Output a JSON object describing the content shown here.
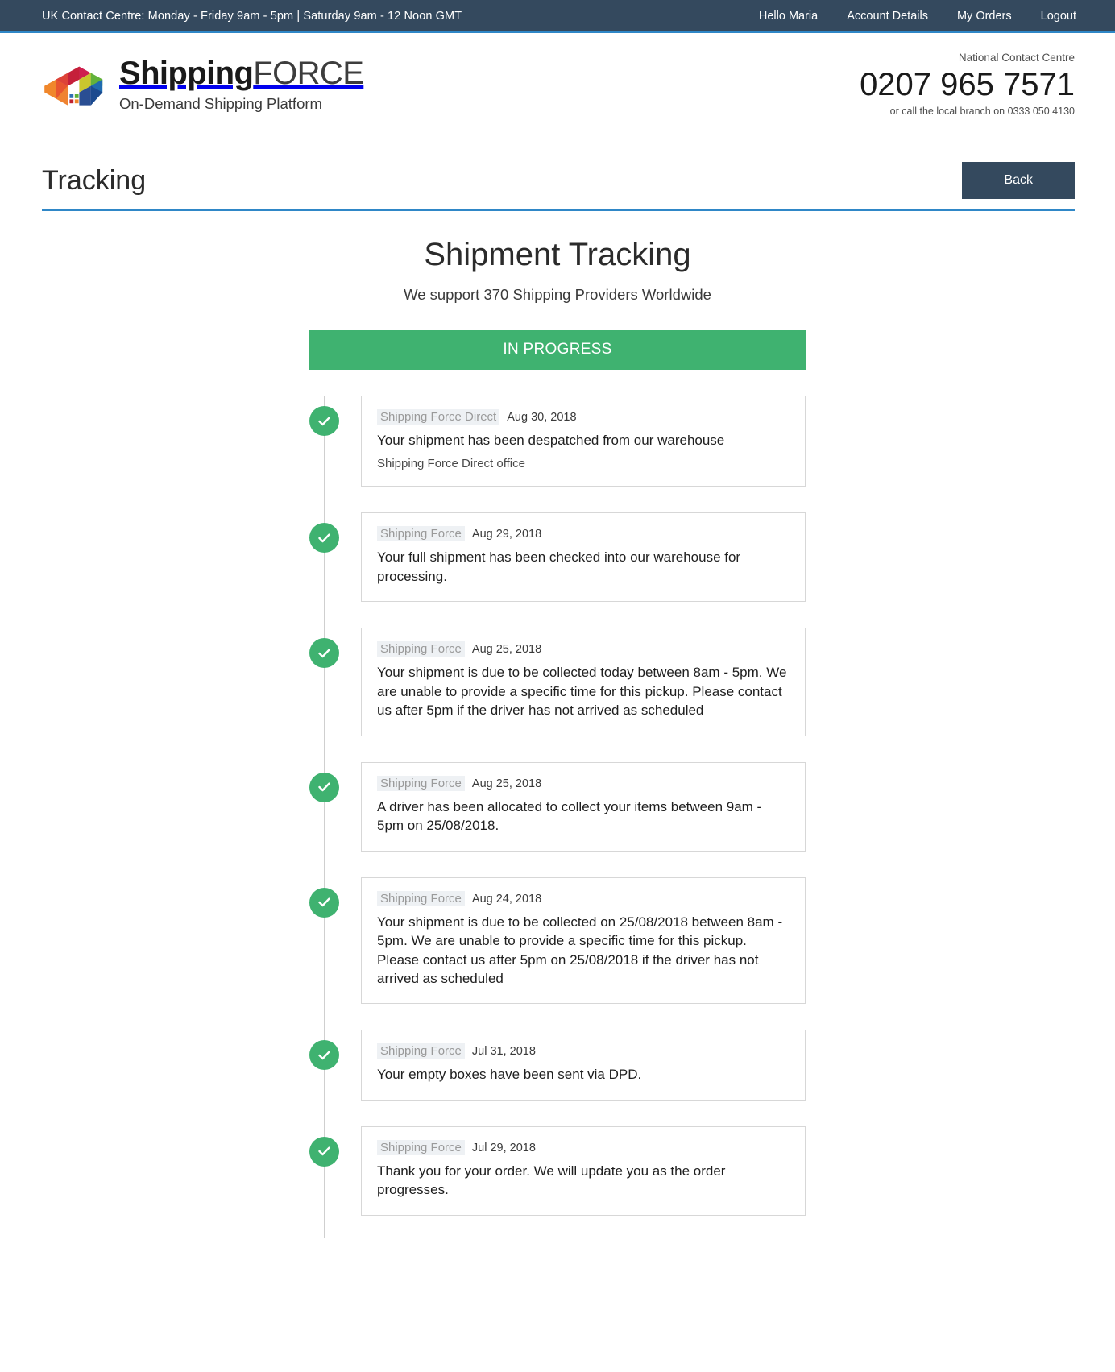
{
  "topbar": {
    "hours": "UK Contact Centre: Monday - Friday 9am - 5pm | Saturday 9am - 12 Noon GMT",
    "links": [
      {
        "label": "Hello Maria"
      },
      {
        "label": "Account Details"
      },
      {
        "label": "My Orders"
      },
      {
        "label": "Logout"
      }
    ]
  },
  "brand": {
    "name_bold": "Shipping",
    "name_thin": "FORCE",
    "tagline": "On-Demand Shipping Platform"
  },
  "contact": {
    "label": "National Contact Centre",
    "number": "0207 965 7571",
    "local": "or call the local branch on 0333 050 4130"
  },
  "page": {
    "title": "Tracking",
    "back_label": "Back"
  },
  "tracking": {
    "heading": "Shipment Tracking",
    "subheading": "We support 370 Shipping Providers Worldwide",
    "status": "IN PROGRESS",
    "events": [
      {
        "source": "Shipping Force Direct",
        "date": "Aug 30, 2018",
        "text": "Your shipment has been despatched from our warehouse",
        "office": "Shipping Force Direct office"
      },
      {
        "source": "Shipping Force",
        "date": "Aug 29, 2018",
        "text": "Your full shipment has been checked into our warehouse for processing."
      },
      {
        "source": "Shipping Force",
        "date": "Aug 25, 2018",
        "text": "Your shipment is due to be collected today between 8am - 5pm. We are unable to provide a specific time for this pickup. Please contact us after 5pm if the driver has not arrived as scheduled"
      },
      {
        "source": "Shipping Force",
        "date": "Aug 25, 2018",
        "text": "A driver has been allocated to collect your items between 9am - 5pm on 25/08/2018."
      },
      {
        "source": "Shipping Force",
        "date": "Aug 24, 2018",
        "text": "Your shipment is due to be collected on 25/08/2018 between 8am - 5pm. We are unable to provide a specific time for this pickup. Please contact us after 5pm on 25/08/2018 if the driver has not arrived as scheduled"
      },
      {
        "source": "Shipping Force",
        "date": "Jul 31, 2018",
        "text": "Your empty boxes have been sent via DPD."
      },
      {
        "source": "Shipping Force",
        "date": "Jul 29, 2018",
        "text": "Thank you for your order. We will update you as the order progresses."
      }
    ]
  },
  "colors": {
    "navy": "#34495e",
    "accent_blue": "#2f87c7",
    "green": "#3fb270"
  }
}
